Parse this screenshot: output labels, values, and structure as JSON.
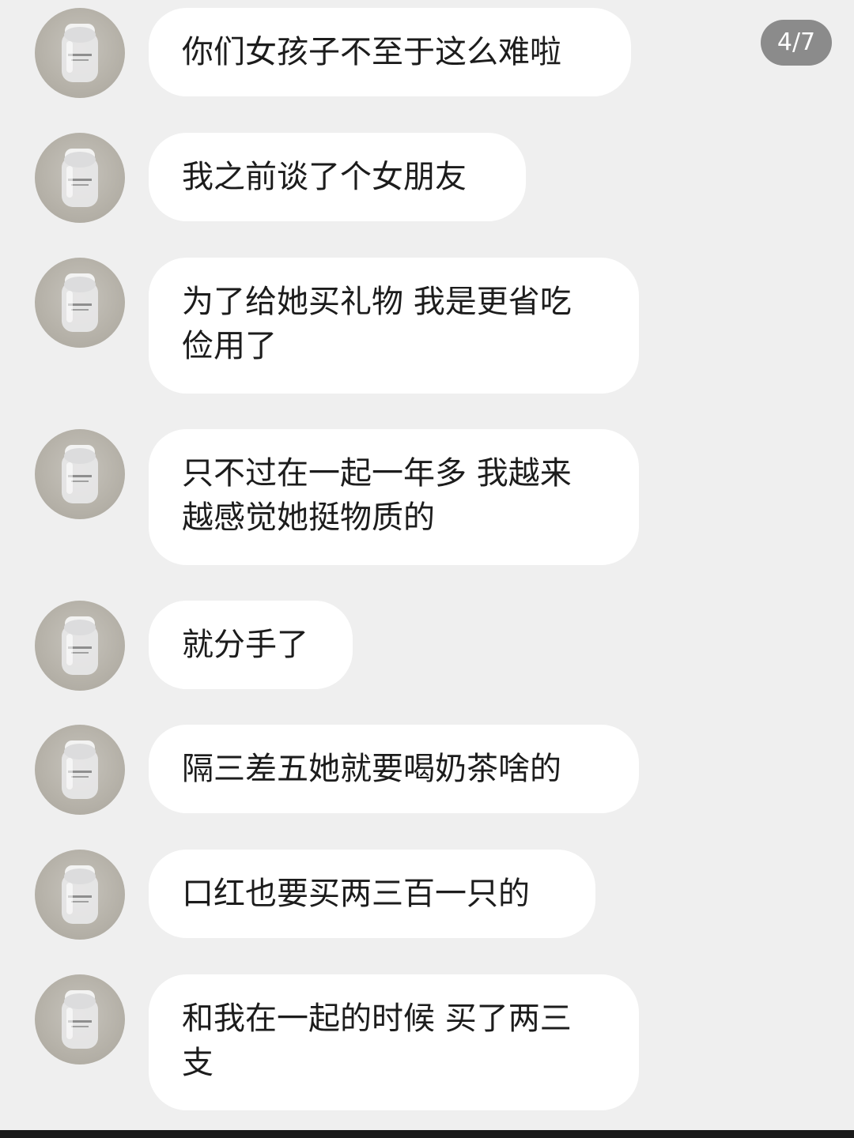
{
  "page_counter": "4/7",
  "messages": [
    {
      "text": "你们女孩子不至于这么难啦"
    },
    {
      "text": "我之前谈了个女朋友"
    },
    {
      "text": "为了给她买礼物 我是更省吃\n俭用了"
    },
    {
      "text": "只不过在一起一年多 我越来\n越感觉她挺物质的"
    },
    {
      "text": "就分手了"
    },
    {
      "text": "隔三差五她就要喝奶茶啥的"
    },
    {
      "text": "口红也要买两三百一只的"
    },
    {
      "text": "和我在一起的时候 买了两三\n支"
    }
  ]
}
